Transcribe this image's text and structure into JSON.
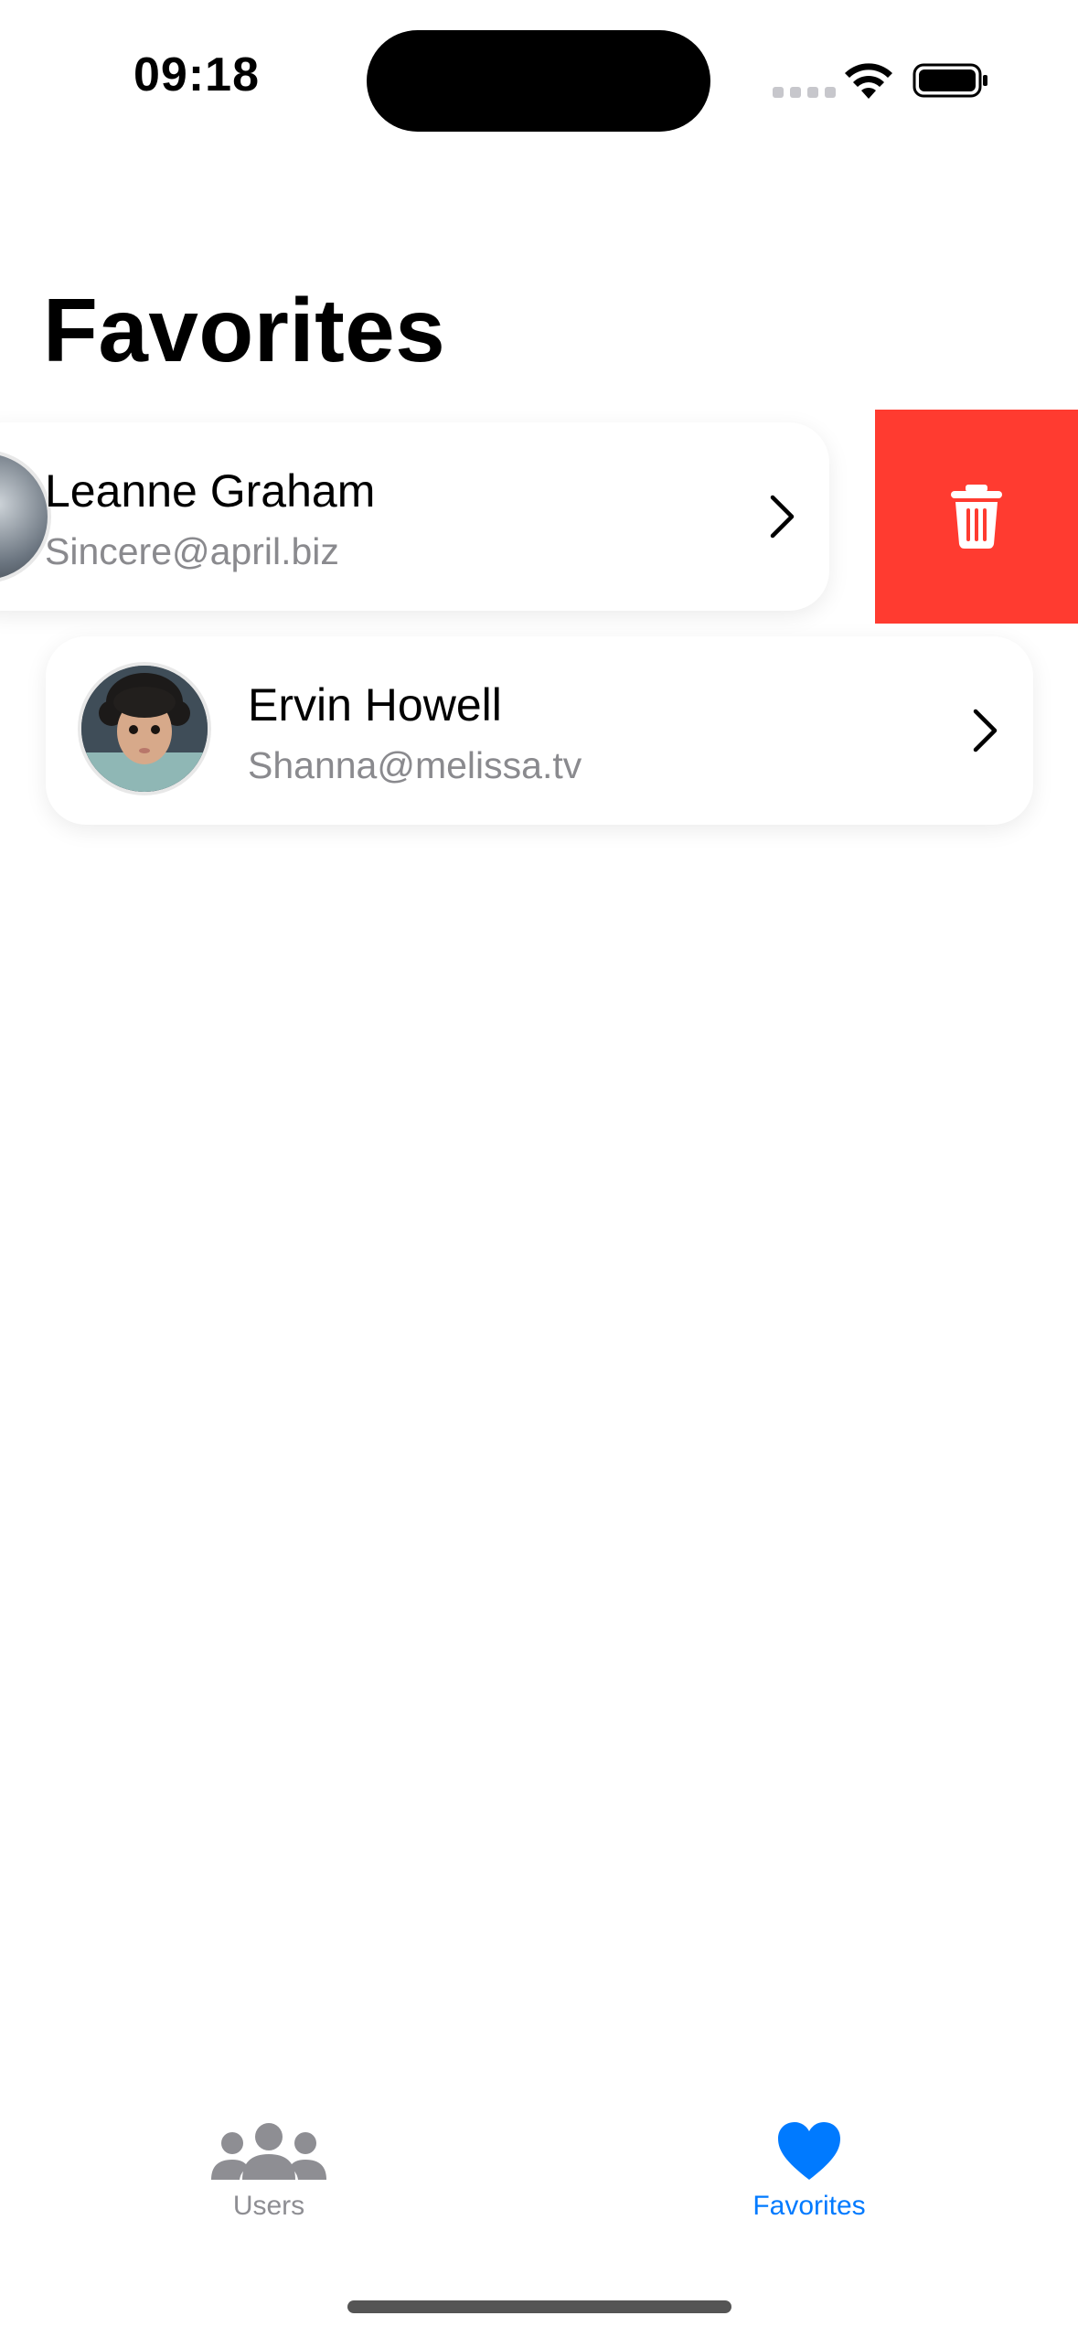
{
  "status_bar": {
    "time": "09:18"
  },
  "page": {
    "title": "Favorites"
  },
  "favorites": [
    {
      "name": "Leanne Graham",
      "email": "Sincere@april.biz",
      "swiped": true
    },
    {
      "name": "Ervin Howell",
      "email": "Shanna@melissa.tv",
      "swiped": false
    }
  ],
  "delete_action": {
    "icon": "trash-icon",
    "color": "#ff3b30"
  },
  "tab_bar": {
    "tabs": [
      {
        "label": "Users",
        "icon": "people-icon",
        "selected": false
      },
      {
        "label": "Favorites",
        "icon": "heart-icon",
        "selected": true
      }
    ],
    "accent_color": "#007aff",
    "inactive_color": "#8e8e93"
  }
}
